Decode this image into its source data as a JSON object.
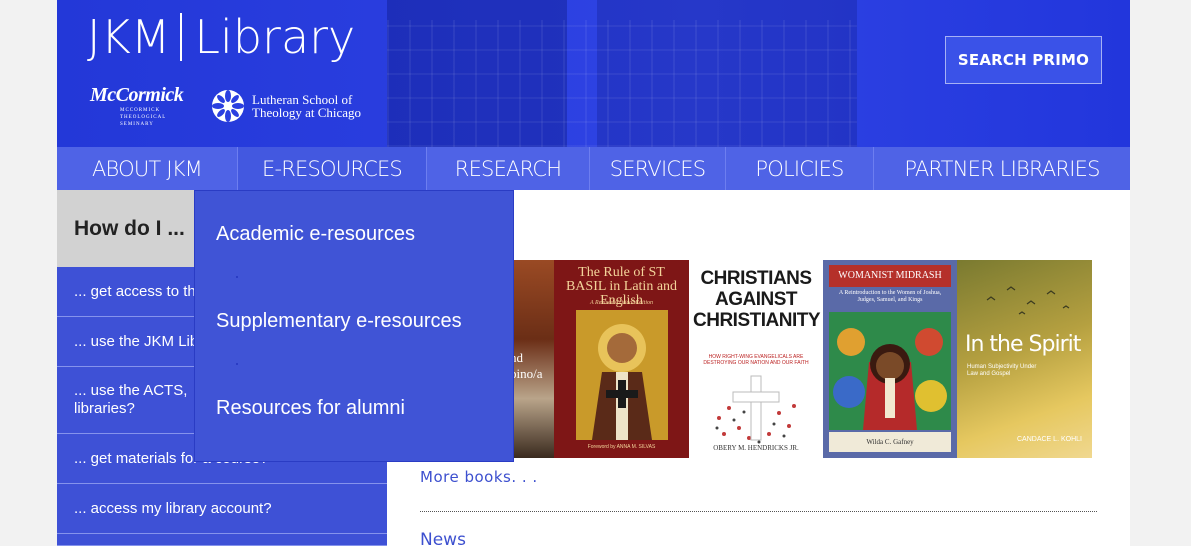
{
  "header": {
    "logo_left": "JKM",
    "logo_right": "Library",
    "mccormick_name": "McCormick",
    "mccormick_sub": "MCCORMICK THEOLOGICAL SEMINARY",
    "lstc_line1": "Lutheran School of",
    "lstc_line2": "Theology at Chicago",
    "search_button": "SEARCH PRIMO"
  },
  "nav": {
    "items": [
      {
        "label": "ABOUT JKM"
      },
      {
        "label": "E-RESOURCES"
      },
      {
        "label": "RESEARCH"
      },
      {
        "label": "SERVICES"
      },
      {
        "label": "POLICIES"
      },
      {
        "label": "PARTNER LIBRARIES"
      }
    ]
  },
  "sidebar": {
    "heading": "How do I ...",
    "items": [
      {
        "label": "... get access to the"
      },
      {
        "label": "... use the JKM Lib"
      },
      {
        "label": "... use the ACTS, libraries?"
      },
      {
        "label": "... get materials for a course?"
      },
      {
        "label": "... access my library account?"
      },
      {
        "label": ""
      }
    ]
  },
  "dropdown": {
    "items": [
      {
        "label": "Academic e-resources"
      },
      {
        "label": "Supplementary e-resources"
      },
      {
        "label": "Resources for alumni"
      }
    ]
  },
  "books": {
    "items": [
      {
        "title": "nd\npino/a"
      },
      {
        "title": "The Rule of ST BASIL in Latin and English",
        "sub": "A Revised Critical Edition",
        "credit": "Foreword by ANNA M. SILVAS"
      },
      {
        "title": "CHRISTIANS AGAINST CHRISTIANITY",
        "sub": "HOW RIGHT-WING EVANGELICALS ARE DESTROYING OUR NATION AND OUR FAITH",
        "credit": "OBERY M. HENDRICKS JR."
      },
      {
        "title": "WOMANIST MIDRASH",
        "sub": "A Reintroduction to the Women of Joshua, Judges, Samuel, and Kings",
        "credit": "Wilda C. Gafney"
      },
      {
        "title": "In the Spirit",
        "sub": "Human Subjectivity Under Law and Gospel",
        "credit": "CANDACE L. KOHLI"
      }
    ],
    "more": "More books. . ."
  },
  "news": {
    "heading": "News"
  }
}
